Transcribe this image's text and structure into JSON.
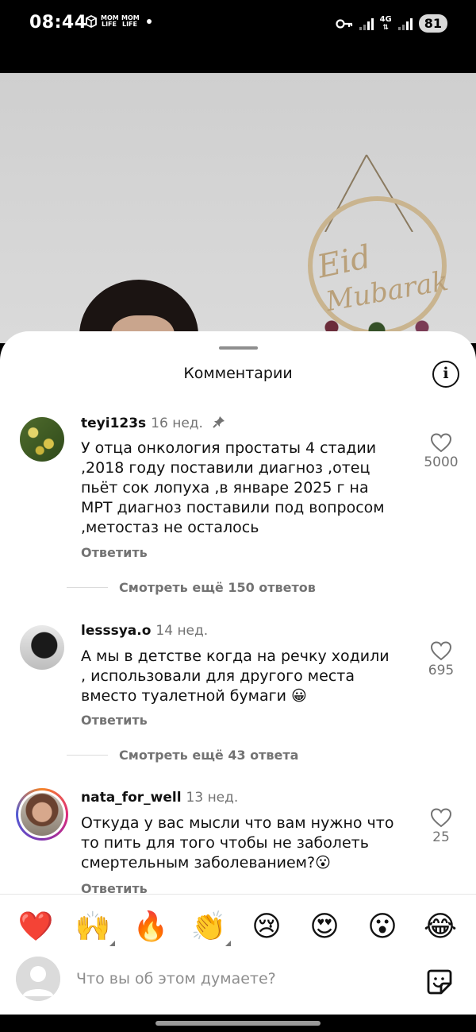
{
  "status_bar": {
    "time": "08:44",
    "app_icons": [
      "MOM LIFE",
      "MOM LIFE"
    ],
    "network": "4G",
    "battery": "81"
  },
  "video": {
    "decor_text_1": "Eid",
    "decor_text_2": "Mubarak"
  },
  "sheet": {
    "title": "Комментарии"
  },
  "comments": [
    {
      "username": "teyi123s",
      "time": "16 нед.",
      "pinned": true,
      "text": "У отца онкология простаты 4 стадии ,2018 году поставили диагноз ,отец пьёт сок лопуха ,в январе 2025 г на МРТ диагноз поставили под вопросом ,метостаз не осталось",
      "reply_label": "Ответить",
      "likes": "5000",
      "view_replies": "Смотреть ещё 150 ответов"
    },
    {
      "username": "lesssya.o",
      "time": "14 нед.",
      "pinned": false,
      "text": "А мы в детстве когда на речку ходили , использовали для другого места вместо туалетной бумаги 😀",
      "reply_label": "Ответить",
      "likes": "695",
      "view_replies": "Смотреть ещё 43 ответа"
    },
    {
      "username": "nata_for_well",
      "time": "13 нед.",
      "pinned": false,
      "text": "Откуда у вас мысли что вам нужно что то пить для того чтобы не заболеть смертельным заболеванием?😮",
      "reply_label": "Ответить",
      "likes": "25"
    }
  ],
  "composer": {
    "emojis": [
      "❤️",
      "🙌",
      "🔥",
      "👏",
      "😢",
      "😍",
      "😮",
      "😂"
    ],
    "placeholder": "Что вы об этом думаете?"
  }
}
